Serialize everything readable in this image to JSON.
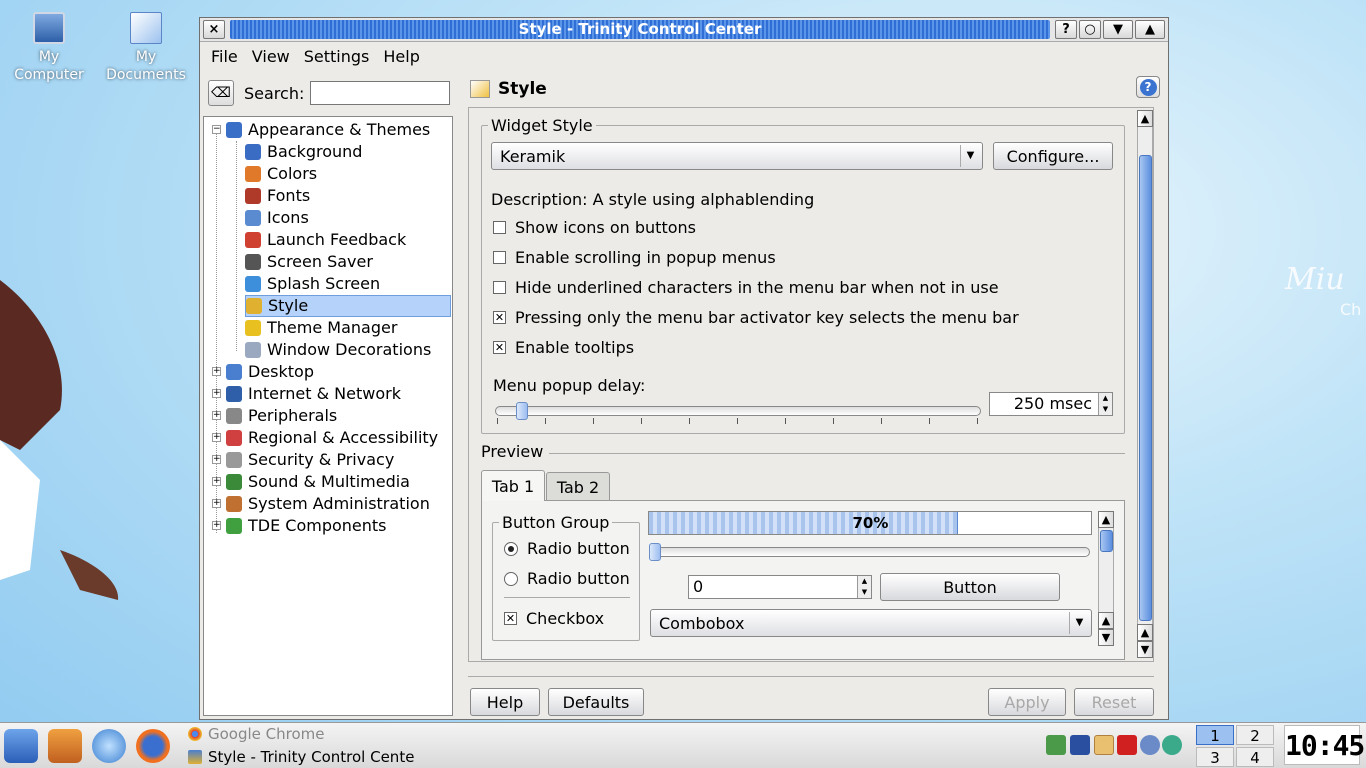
{
  "desktop": {
    "icons": [
      {
        "label": "My Computer",
        "icon": "computer-icon"
      },
      {
        "label": "My Documents",
        "icon": "documents-icon"
      }
    ],
    "wallpaper_text": [
      "Miu",
      "Ch"
    ]
  },
  "window": {
    "title": "Style - Trinity Control Center",
    "buttons": {
      "close": "×",
      "help": "?",
      "sticky": "○",
      "minimize": "▼",
      "maximize": "▲"
    },
    "menu": [
      "File",
      "View",
      "Settings",
      "Help"
    ]
  },
  "sidebar": {
    "search_label": "Search:",
    "search_value": "",
    "tree": [
      {
        "label": "Appearance & Themes",
        "color": "#3a6fc8",
        "children": [
          {
            "label": "Background",
            "color": "#3b6cc4"
          },
          {
            "label": "Colors",
            "color": "#e07a2a"
          },
          {
            "label": "Fonts",
            "color": "#b03a2a"
          },
          {
            "label": "Icons",
            "color": "#5a8ad0"
          },
          {
            "label": "Launch Feedback",
            "color": "#d04030"
          },
          {
            "label": "Screen Saver",
            "color": "#555555"
          },
          {
            "label": "Splash Screen",
            "color": "#3d8fdc"
          },
          {
            "label": "Style",
            "color": "#e0b030",
            "selected": true
          },
          {
            "label": "Theme Manager",
            "color": "#e8c020"
          },
          {
            "label": "Window Decorations",
            "color": "#9aa8c0"
          }
        ]
      },
      {
        "label": "Desktop",
        "color": "#4a7fd0"
      },
      {
        "label": "Internet & Network",
        "color": "#2f5fa8"
      },
      {
        "label": "Peripherals",
        "color": "#888888"
      },
      {
        "label": "Regional & Accessibility",
        "color": "#d04040"
      },
      {
        "label": "Security & Privacy",
        "color": "#999999"
      },
      {
        "label": "Sound & Multimedia",
        "color": "#3a8a3a"
      },
      {
        "label": "System Administration",
        "color": "#c07030"
      },
      {
        "label": "TDE Components",
        "color": "#40a040"
      }
    ]
  },
  "page": {
    "title": "Style",
    "widget_style": {
      "legend": "Widget Style",
      "selected": "Keramik",
      "configure": "Configure...",
      "description": "Description: A style using alphablending",
      "options": [
        {
          "label": "Show icons on buttons",
          "checked": false
        },
        {
          "label": "Enable scrolling in popup menus",
          "checked": false
        },
        {
          "label": "Hide underlined characters in the menu bar when not in use",
          "checked": false
        },
        {
          "label": "Pressing only the menu bar activator key selects the menu bar",
          "checked": true
        },
        {
          "label": "Enable tooltips",
          "checked": true
        }
      ],
      "delay_label": "Menu popup delay:",
      "delay_value": "250 msec"
    },
    "preview": {
      "legend": "Preview",
      "tabs": [
        "Tab 1",
        "Tab 2"
      ],
      "button_group": "Button Group",
      "radio1": "Radio button",
      "radio2": "Radio button",
      "checkbox": "Checkbox",
      "progress": "70%",
      "progress_fraction": 0.7,
      "spin_value": "0",
      "button": "Button",
      "combobox": "Combobox"
    },
    "buttons": {
      "help": "Help",
      "defaults": "Defaults",
      "apply": "Apply",
      "reset": "Reset"
    }
  },
  "taskbar": {
    "tasks": [
      "Google Chrome",
      "Style - Trinity Control Cente"
    ],
    "pager": [
      "1",
      "2",
      "3",
      "4"
    ],
    "clock": "10:45"
  }
}
